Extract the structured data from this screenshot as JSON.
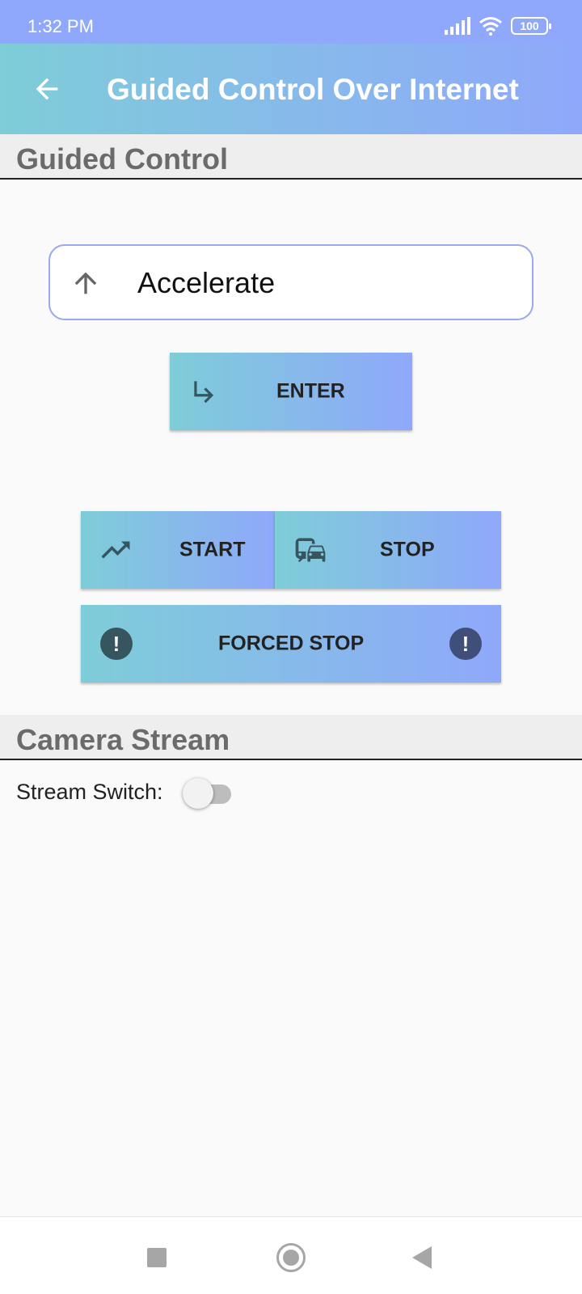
{
  "status_bar": {
    "time": "1:32 PM",
    "battery": "100"
  },
  "app_bar": {
    "title": "Guided Control Over Internet",
    "back_icon": "arrow-back-icon"
  },
  "guided_section": {
    "title": "Guided Control"
  },
  "command": {
    "value": "Accelerate",
    "icon": "arrow-up-icon"
  },
  "buttons": {
    "enter": {
      "label": "ENTER",
      "icon": "subdirectory-arrow-right-icon"
    },
    "start": {
      "label": "START",
      "icon": "trending-up-icon"
    },
    "stop": {
      "label": "STOP",
      "icon": "commute-icon"
    },
    "forced_stop": {
      "label": "FORCED STOP",
      "icon": "alert-circle-icon"
    }
  },
  "camera_section": {
    "title": "Camera Stream",
    "stream_label": "Stream Switch:",
    "stream_on": false
  },
  "colors": {
    "gradient_start": "#7ecdd8",
    "gradient_end": "#8fa8fb",
    "alert_left": "#37555e",
    "alert_right": "#3f4f7a"
  }
}
